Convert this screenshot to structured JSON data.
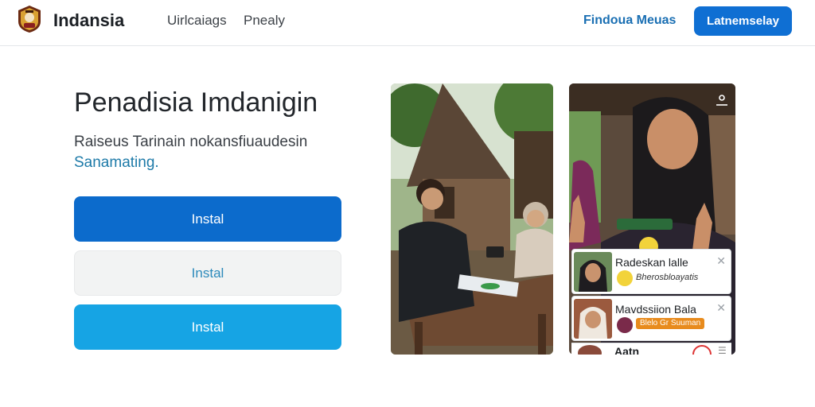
{
  "header": {
    "brand": "Indansia",
    "nav": [
      "Uirlcaiags",
      "Pnealy"
    ],
    "find_link": "Findoua Meuas",
    "cta": "Latnemselay"
  },
  "hero": {
    "title": "Penadisia Imdanigin",
    "subtitle_line1": "Raiseus Tarinain nokansfiuaudesin",
    "subtitle_line2": "Sanamating."
  },
  "buttons": [
    "Instal",
    "Instal",
    "Instal"
  ],
  "cards": [
    {
      "name": "Radeskan lalle",
      "sub": "Bherosbloayatis"
    },
    {
      "name": "Mavdssiion Bala",
      "badge": "Blelo Gr Suuman"
    },
    {
      "name": "Aatn"
    }
  ],
  "colors": {
    "primary": "#0c6bcc",
    "accent": "#16a4e4",
    "link": "#1a6fb3",
    "badge": "#e88b1d"
  },
  "icons": [
    "crest-logo-icon",
    "user-icon",
    "close-icon",
    "menu-icon"
  ]
}
